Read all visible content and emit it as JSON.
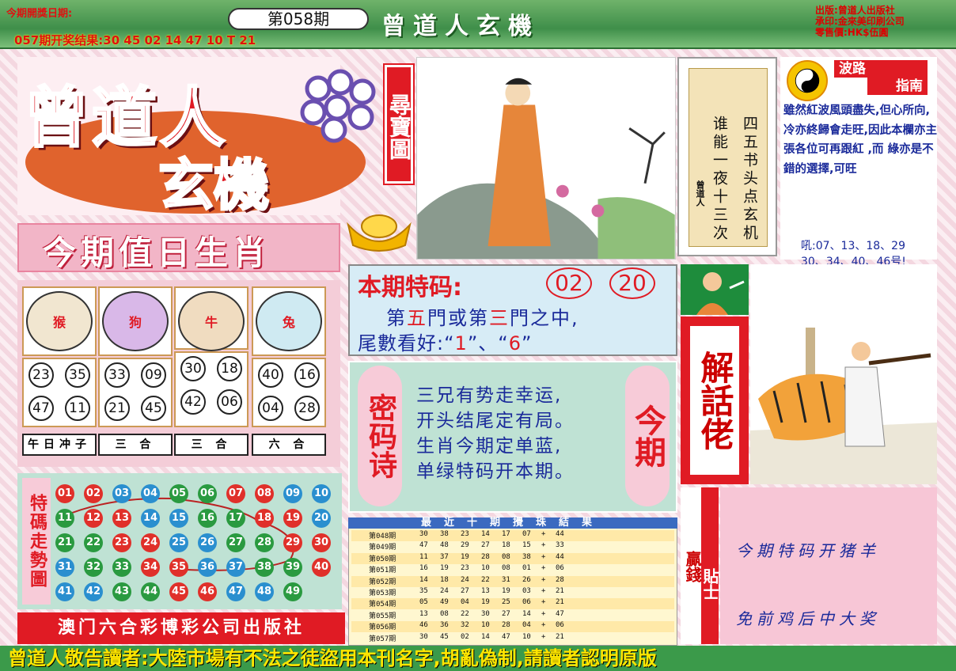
{
  "header": {
    "issue_date_label": "今期開獎日期:",
    "prev_result": "057期开奖结果:30 45 02 14 47 10 T 21",
    "issue_no": "第058期",
    "masthead": "曾道人玄機",
    "publisher_lines": [
      "出版:曾道人出版社",
      "承印:金來美印刷公司",
      "零售價:HK$伍圓"
    ]
  },
  "logo": {
    "line1": "曾道人",
    "line2": "玄機",
    "treasure": "尋寶圖"
  },
  "poem": {
    "col1": "四五书头点玄机",
    "col2": "谁能一夜十三次",
    "signature": "曾道人"
  },
  "guide": {
    "title1": "波路",
    "title2": "指南",
    "body": "雖然紅波風頭盡失,但心所向,冷亦終歸會走旺,因此本欄亦主張各位可再跟紅 ,而 綠亦是不錯的選擇,可旺",
    "nums_prefix": "吼:",
    "nums_line1": "07、13、18、29",
    "nums_line2": "30、34、40、46号!"
  },
  "zodiac": {
    "title": "今期值日生肖",
    "animals": [
      {
        "name": "猴",
        "balls": [
          "23",
          "35",
          "47",
          "11"
        ],
        "label": "午日冲子",
        "color": "#f1e6d0"
      },
      {
        "name": "狗",
        "balls": [
          "33",
          "09",
          "21",
          "45"
        ],
        "label": "三 合",
        "color": "#d9b8e8"
      },
      {
        "name": "牛",
        "balls": [
          "30",
          "18",
          "42",
          "06"
        ],
        "label": "三 合",
        "color": "#f0dcc0"
      },
      {
        "name": "兔",
        "balls": [
          "40",
          "16",
          "04",
          "28"
        ],
        "label": "六 合",
        "color": "#cfeaf2"
      }
    ]
  },
  "trend": {
    "label": "特碼走勢圖",
    "colors": {
      "red": "#e0302a",
      "blue": "#2a8fcf",
      "green": "#2a9a40"
    },
    "rows": [
      [
        [
          "01",
          "red"
        ],
        [
          "02",
          "red"
        ],
        [
          "03",
          "blue"
        ],
        [
          "04",
          "blue"
        ],
        [
          "05",
          "green"
        ],
        [
          "06",
          "green"
        ],
        [
          "07",
          "red"
        ],
        [
          "08",
          "red"
        ],
        [
          "09",
          "blue"
        ],
        [
          "10",
          "blue"
        ]
      ],
      [
        [
          "11",
          "green"
        ],
        [
          "12",
          "red"
        ],
        [
          "13",
          "red"
        ],
        [
          "14",
          "blue"
        ],
        [
          "15",
          "blue"
        ],
        [
          "16",
          "green"
        ],
        [
          "17",
          "green"
        ],
        [
          "18",
          "red"
        ],
        [
          "19",
          "red"
        ],
        [
          "20",
          "blue"
        ]
      ],
      [
        [
          "21",
          "green"
        ],
        [
          "22",
          "green"
        ],
        [
          "23",
          "red"
        ],
        [
          "24",
          "red"
        ],
        [
          "25",
          "blue"
        ],
        [
          "26",
          "blue"
        ],
        [
          "27",
          "green"
        ],
        [
          "28",
          "green"
        ],
        [
          "29",
          "red"
        ],
        [
          "30",
          "red"
        ]
      ],
      [
        [
          "31",
          "blue"
        ],
        [
          "32",
          "green"
        ],
        [
          "33",
          "green"
        ],
        [
          "34",
          "red"
        ],
        [
          "35",
          "red"
        ],
        [
          "36",
          "blue"
        ],
        [
          "37",
          "blue"
        ],
        [
          "38",
          "green"
        ],
        [
          "39",
          "green"
        ],
        [
          "40",
          "red"
        ]
      ],
      [
        [
          "41",
          "blue"
        ],
        [
          "42",
          "blue"
        ],
        [
          "43",
          "green"
        ],
        [
          "44",
          "green"
        ],
        [
          "45",
          "red"
        ],
        [
          "46",
          "red"
        ],
        [
          "47",
          "blue"
        ],
        [
          "48",
          "blue"
        ],
        [
          "49",
          "green"
        ]
      ]
    ]
  },
  "publisher_bar": "澳门六合彩博彩公司出版社",
  "special": {
    "title": "本期特码:",
    "num1": "02",
    "num2": "20",
    "line1_a": "第",
    "line1_b": "五",
    "line1_c": "門或第",
    "line1_d": "三",
    "line1_e": "門之中,",
    "line2_a": "尾數看好:“",
    "line2_b": "1",
    "line2_c": "”、“",
    "line2_d": "6",
    "line2_e": "”"
  },
  "secret": {
    "left": "密码诗",
    "right": "今期",
    "lines": [
      "三兄有势走幸运,",
      "开头结尾定有局。",
      "生肖今期定单蓝,",
      "单绿特码开本期。"
    ]
  },
  "recent": {
    "title": "最近十期攪珠結果",
    "rows": [
      [
        "第048期",
        "30",
        "38",
        "23",
        "14",
        "17",
        "07",
        "+",
        "44"
      ],
      [
        "第049期",
        "47",
        "48",
        "29",
        "27",
        "18",
        "15",
        "+",
        "33"
      ],
      [
        "第050期",
        "11",
        "37",
        "19",
        "28",
        "08",
        "38",
        "+",
        "44"
      ],
      [
        "第051期",
        "16",
        "19",
        "23",
        "10",
        "08",
        "01",
        "+",
        "06"
      ],
      [
        "第052期",
        "14",
        "18",
        "24",
        "22",
        "31",
        "26",
        "+",
        "28"
      ],
      [
        "第053期",
        "35",
        "24",
        "27",
        "13",
        "19",
        "03",
        "+",
        "21"
      ],
      [
        "第054期",
        "05",
        "49",
        "04",
        "19",
        "25",
        "06",
        "+",
        "21"
      ],
      [
        "第055期",
        "13",
        "08",
        "22",
        "30",
        "27",
        "14",
        "+",
        "47"
      ],
      [
        "第056期",
        "46",
        "36",
        "32",
        "10",
        "28",
        "04",
        "+",
        "06"
      ],
      [
        "第057期",
        "30",
        "45",
        "02",
        "14",
        "47",
        "10",
        "+",
        "21"
      ]
    ]
  },
  "jie": "解話佬",
  "win": {
    "col1": "贏錢",
    "col2": "貼士"
  },
  "tips": {
    "line1": "今期特码开猪羊",
    "line2": "免前鸡后中大奖"
  },
  "footer": "曾道人敬告讀者:大陸市場有不法之徒盜用本刊名字,胡亂偽制,請讀者認明原版"
}
